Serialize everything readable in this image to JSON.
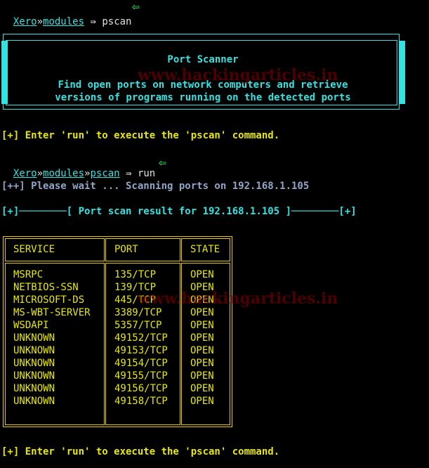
{
  "prompt1": {
    "host": "Xero",
    "sep": "»",
    "module": "modules",
    "symbol": "⇛",
    "command": "pscan"
  },
  "banner": {
    "title": "Port Scanner",
    "desc_line1": "Find open ports on network computers and retrieve",
    "desc_line2": "versions of programs running on the detected ports"
  },
  "hint1": "[+] Enter 'run' to execute the 'pscan' command.",
  "prompt2": {
    "host": "Xero",
    "sep1": "»",
    "module": "modules",
    "sep2": "»",
    "submodule": "pscan",
    "symbol": "⇛",
    "command": "run"
  },
  "wait_msg": "[++] Please wait ... Scanning ports on 192.168.1.105",
  "result_header": "[+]────────[ Port scan result for 192.168.1.105 ]────────[+]",
  "table": {
    "headers": [
      "SERVICE",
      "PORT",
      "STATE"
    ],
    "rows": [
      [
        "MSRPC",
        "135/TCP",
        "OPEN"
      ],
      [
        "NETBIOS-SSN",
        "139/TCP",
        "OPEN"
      ],
      [
        "MICROSOFT-DS",
        "445/TCP",
        "OPEN"
      ],
      [
        "MS-WBT-SERVER",
        "3389/TCP",
        "OPEN"
      ],
      [
        "WSDAPI",
        "5357/TCP",
        "OPEN"
      ],
      [
        "UNKNOWN",
        "49152/TCP",
        "OPEN"
      ],
      [
        "UNKNOWN",
        "49153/TCP",
        "OPEN"
      ],
      [
        "UNKNOWN",
        "49154/TCP",
        "OPEN"
      ],
      [
        "UNKNOWN",
        "49155/TCP",
        "OPEN"
      ],
      [
        "UNKNOWN",
        "49156/TCP",
        "OPEN"
      ],
      [
        "UNKNOWN",
        "49158/TCP",
        "OPEN"
      ]
    ]
  },
  "hint2": "[+] Enter 'run' to execute the 'pscan' command.",
  "watermark": "www.hackingarticles.in",
  "colors": {
    "cyan": "#34e2e2",
    "yellow": "#e8e800",
    "arrow_green": "#2fd24a"
  },
  "icons": {
    "pointer_arrow": "left-arrow-icon"
  }
}
